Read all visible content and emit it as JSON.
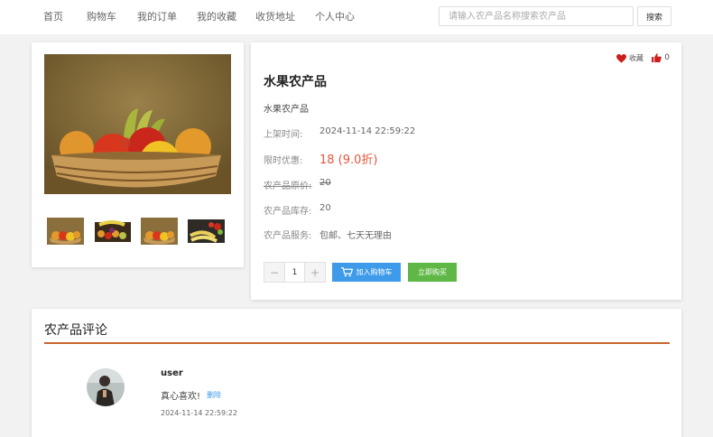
{
  "nav": {
    "items": [
      "首页",
      "购物车",
      "我的订单",
      "我的收藏",
      "收货地址",
      "个人中心"
    ],
    "search_placeholder": "请输入农产品名称搜索农产品",
    "search_button": "搜索"
  },
  "product": {
    "fav_label": "收藏",
    "like_count": "0",
    "title": "水果农产品",
    "subtitle": "水果农产品",
    "rows": [
      {
        "label": "上架时间:",
        "value": "2024-11-14 22:59:22"
      },
      {
        "label": "限时优惠:",
        "value": "18  (9.0折)"
      },
      {
        "label": "农产品原价:",
        "value": "20"
      },
      {
        "label": "农产品库存:",
        "value": "20"
      },
      {
        "label": "农产品服务:",
        "value": "包邮、七天无理由"
      }
    ],
    "quantity": "1",
    "minus": "−",
    "plus": "+",
    "cart_button": "加入购物车",
    "buy_button": "立即购买"
  },
  "reviews": {
    "title": "农产品评论",
    "items": [
      {
        "user": "user",
        "text": "真心喜欢!",
        "delete": "删除",
        "time": "2024-11-14 22:59:22"
      }
    ]
  },
  "colors": {
    "accent_orange": "#c8662e",
    "price_red": "#e4553b",
    "cart_blue": "#3d9be9",
    "buy_green": "#5fb846"
  }
}
